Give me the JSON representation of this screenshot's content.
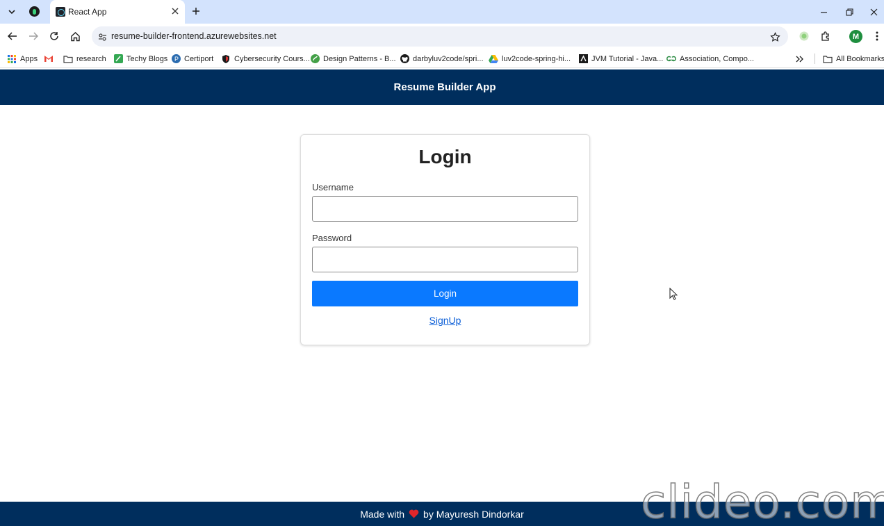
{
  "browser": {
    "tab_title": "React App",
    "url": "resume-builder-frontend.azurewebsites.net",
    "profile_initial": "M",
    "accent": "#d3e3fd"
  },
  "bookmarks": {
    "items": [
      {
        "label": "Apps",
        "icon": "apps-grid-icon"
      },
      {
        "label": "",
        "icon": "gmail-icon"
      },
      {
        "label": "research",
        "icon": "folder-icon"
      },
      {
        "label": "Techy Blogs",
        "icon": "blog-icon"
      },
      {
        "label": "Certiport",
        "icon": "certiport-icon"
      },
      {
        "label": "Cybersecurity Cours...",
        "icon": "shield-icon"
      },
      {
        "label": "Design Patterns - B...",
        "icon": "design-patterns-icon"
      },
      {
        "label": "darbyluv2code/spri...",
        "icon": "github-icon"
      },
      {
        "label": "luv2code-spring-hi...",
        "icon": "drive-icon"
      },
      {
        "label": "JVM Tutorial - Java...",
        "icon": "jvm-icon"
      },
      {
        "label": "Association, Compo...",
        "icon": "gfg-icon"
      }
    ],
    "all_bookmarks": "All Bookmarks"
  },
  "app": {
    "title": "Resume Builder App",
    "brand_color": "#002e5d",
    "button_color": "#0a79ff"
  },
  "login": {
    "heading": "Login",
    "username_label": "Username",
    "username_value": "",
    "password_label": "Password",
    "password_value": "",
    "submit_label": "Login",
    "signup_link": "SignUp"
  },
  "footer": {
    "prefix": "Made with",
    "suffix": "by Mayuresh Dindorkar"
  },
  "watermark": "clideo.com"
}
